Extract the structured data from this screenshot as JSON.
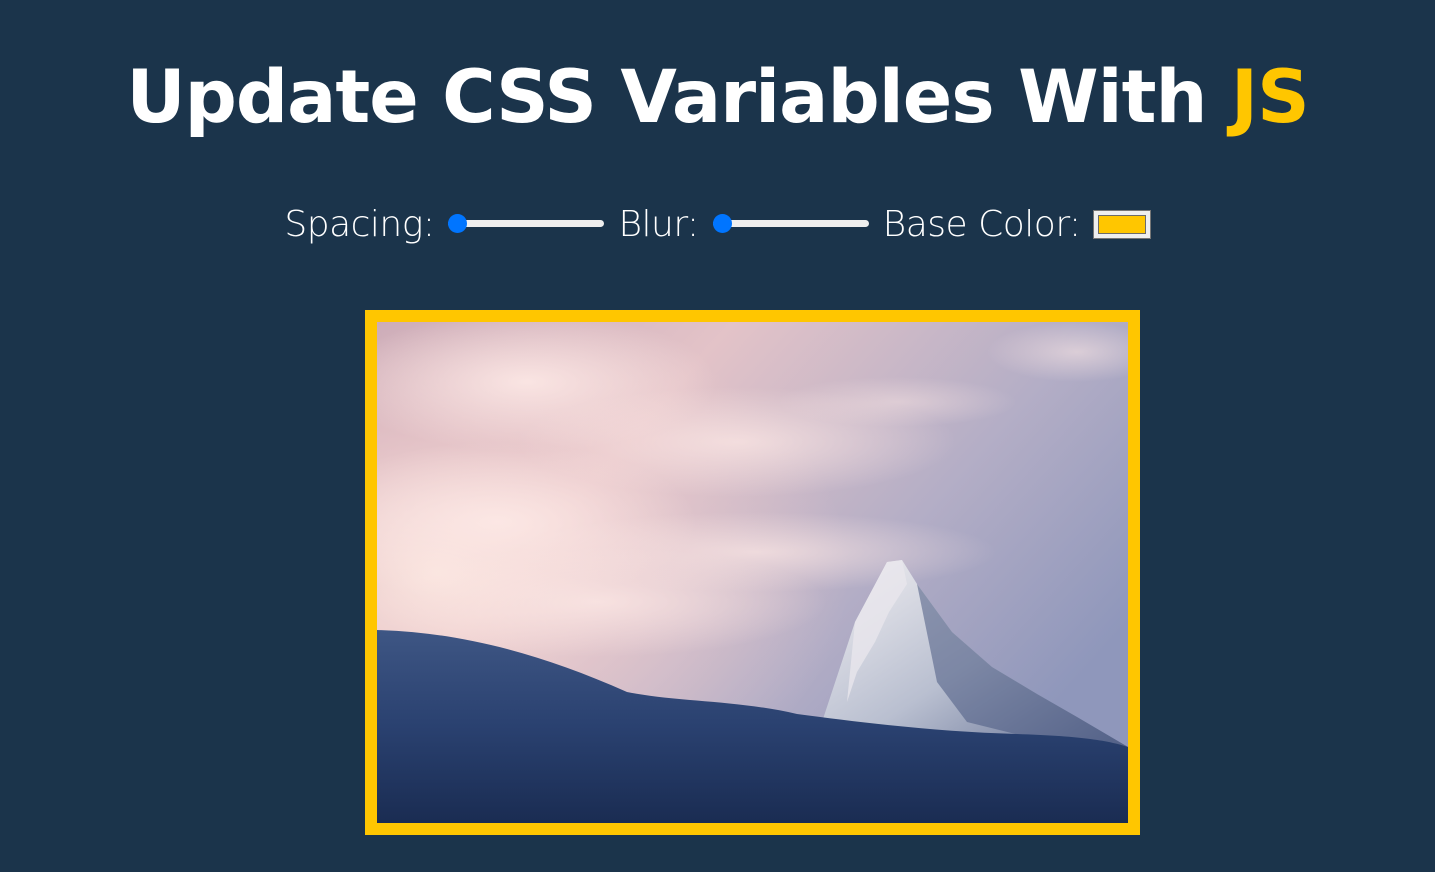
{
  "header": {
    "title_main": "Update CSS Variables With ",
    "title_highlight": "JS"
  },
  "controls": {
    "spacing_label": "Spacing:",
    "spacing_value": 10,
    "spacing_min": 10,
    "spacing_max": 200,
    "blur_label": "Blur:",
    "blur_value": 0,
    "blur_min": 0,
    "blur_max": 25,
    "base_color_label": "Base Color:",
    "base_color_value": "#ffc600"
  },
  "photo": {
    "subject": "snowy-mountain-peak-at-dusk"
  },
  "colors": {
    "background": "#1b344b",
    "accent": "#ffc600",
    "slider": "#0075ff"
  }
}
